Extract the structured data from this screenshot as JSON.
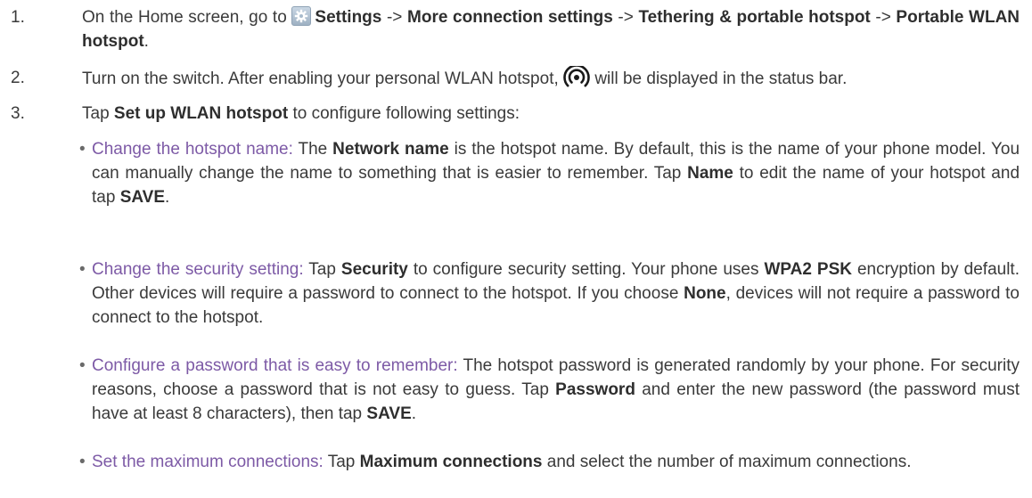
{
  "steps": [
    {
      "number": "1.",
      "segments": [
        "On the Home screen, go to",
        "Settings",
        " -> ",
        "More connection settings",
        " -> ",
        "Tethering & portable hotspot",
        " -> ",
        "Portable WLAN hotspot",
        "."
      ]
    },
    {
      "number": "2.",
      "segments": [
        "Turn on the switch. After enabling your personal WLAN hotspot,",
        "will be displayed in the status bar."
      ]
    },
    {
      "number": "3.",
      "segments": [
        "Tap ",
        "Set up WLAN hotspot",
        " to configure following settings:"
      ]
    }
  ],
  "bullets": [
    {
      "lead": "Change the hotspot name:",
      "segments": [
        " The ",
        "Network name",
        " is the hotspot name. By default, this is the name of your phone model. You can manually change the name to something that is easier to remember. Tap ",
        "Name",
        " to edit the name of your hotspot and tap ",
        "SAVE",
        "."
      ]
    },
    {
      "lead": "Change the security setting:",
      "segments": [
        " Tap ",
        "Security",
        " to configure security setting. Your phone uses ",
        "WPA2 PSK",
        " encryption by default. Other devices will require a password to connect to the hotspot. If you choose ",
        "None",
        ", devices will not require a password to connect to the hotspot."
      ]
    },
    {
      "lead": "Configure a password that is easy to remember:",
      "segments": [
        " The hotspot password is generated randomly by your phone. For security reasons, choose a password that is not easy to guess. Tap ",
        "Password",
        " and enter the new password (the password must have at least 8 characters), then tap ",
        "SAVE",
        "."
      ]
    },
    {
      "lead": "Set the maximum connections:",
      "segments": [
        " Tap ",
        "Maximum connections",
        " and select the number of maximum connections."
      ]
    }
  ],
  "bullet_glyph": "•",
  "icons": {
    "settings": "gear-icon",
    "hotspot": "hotspot-icon"
  },
  "colors": {
    "text": "#3a3a3a",
    "bold": "#2e2e2e",
    "lead": "#7d5aa6"
  }
}
